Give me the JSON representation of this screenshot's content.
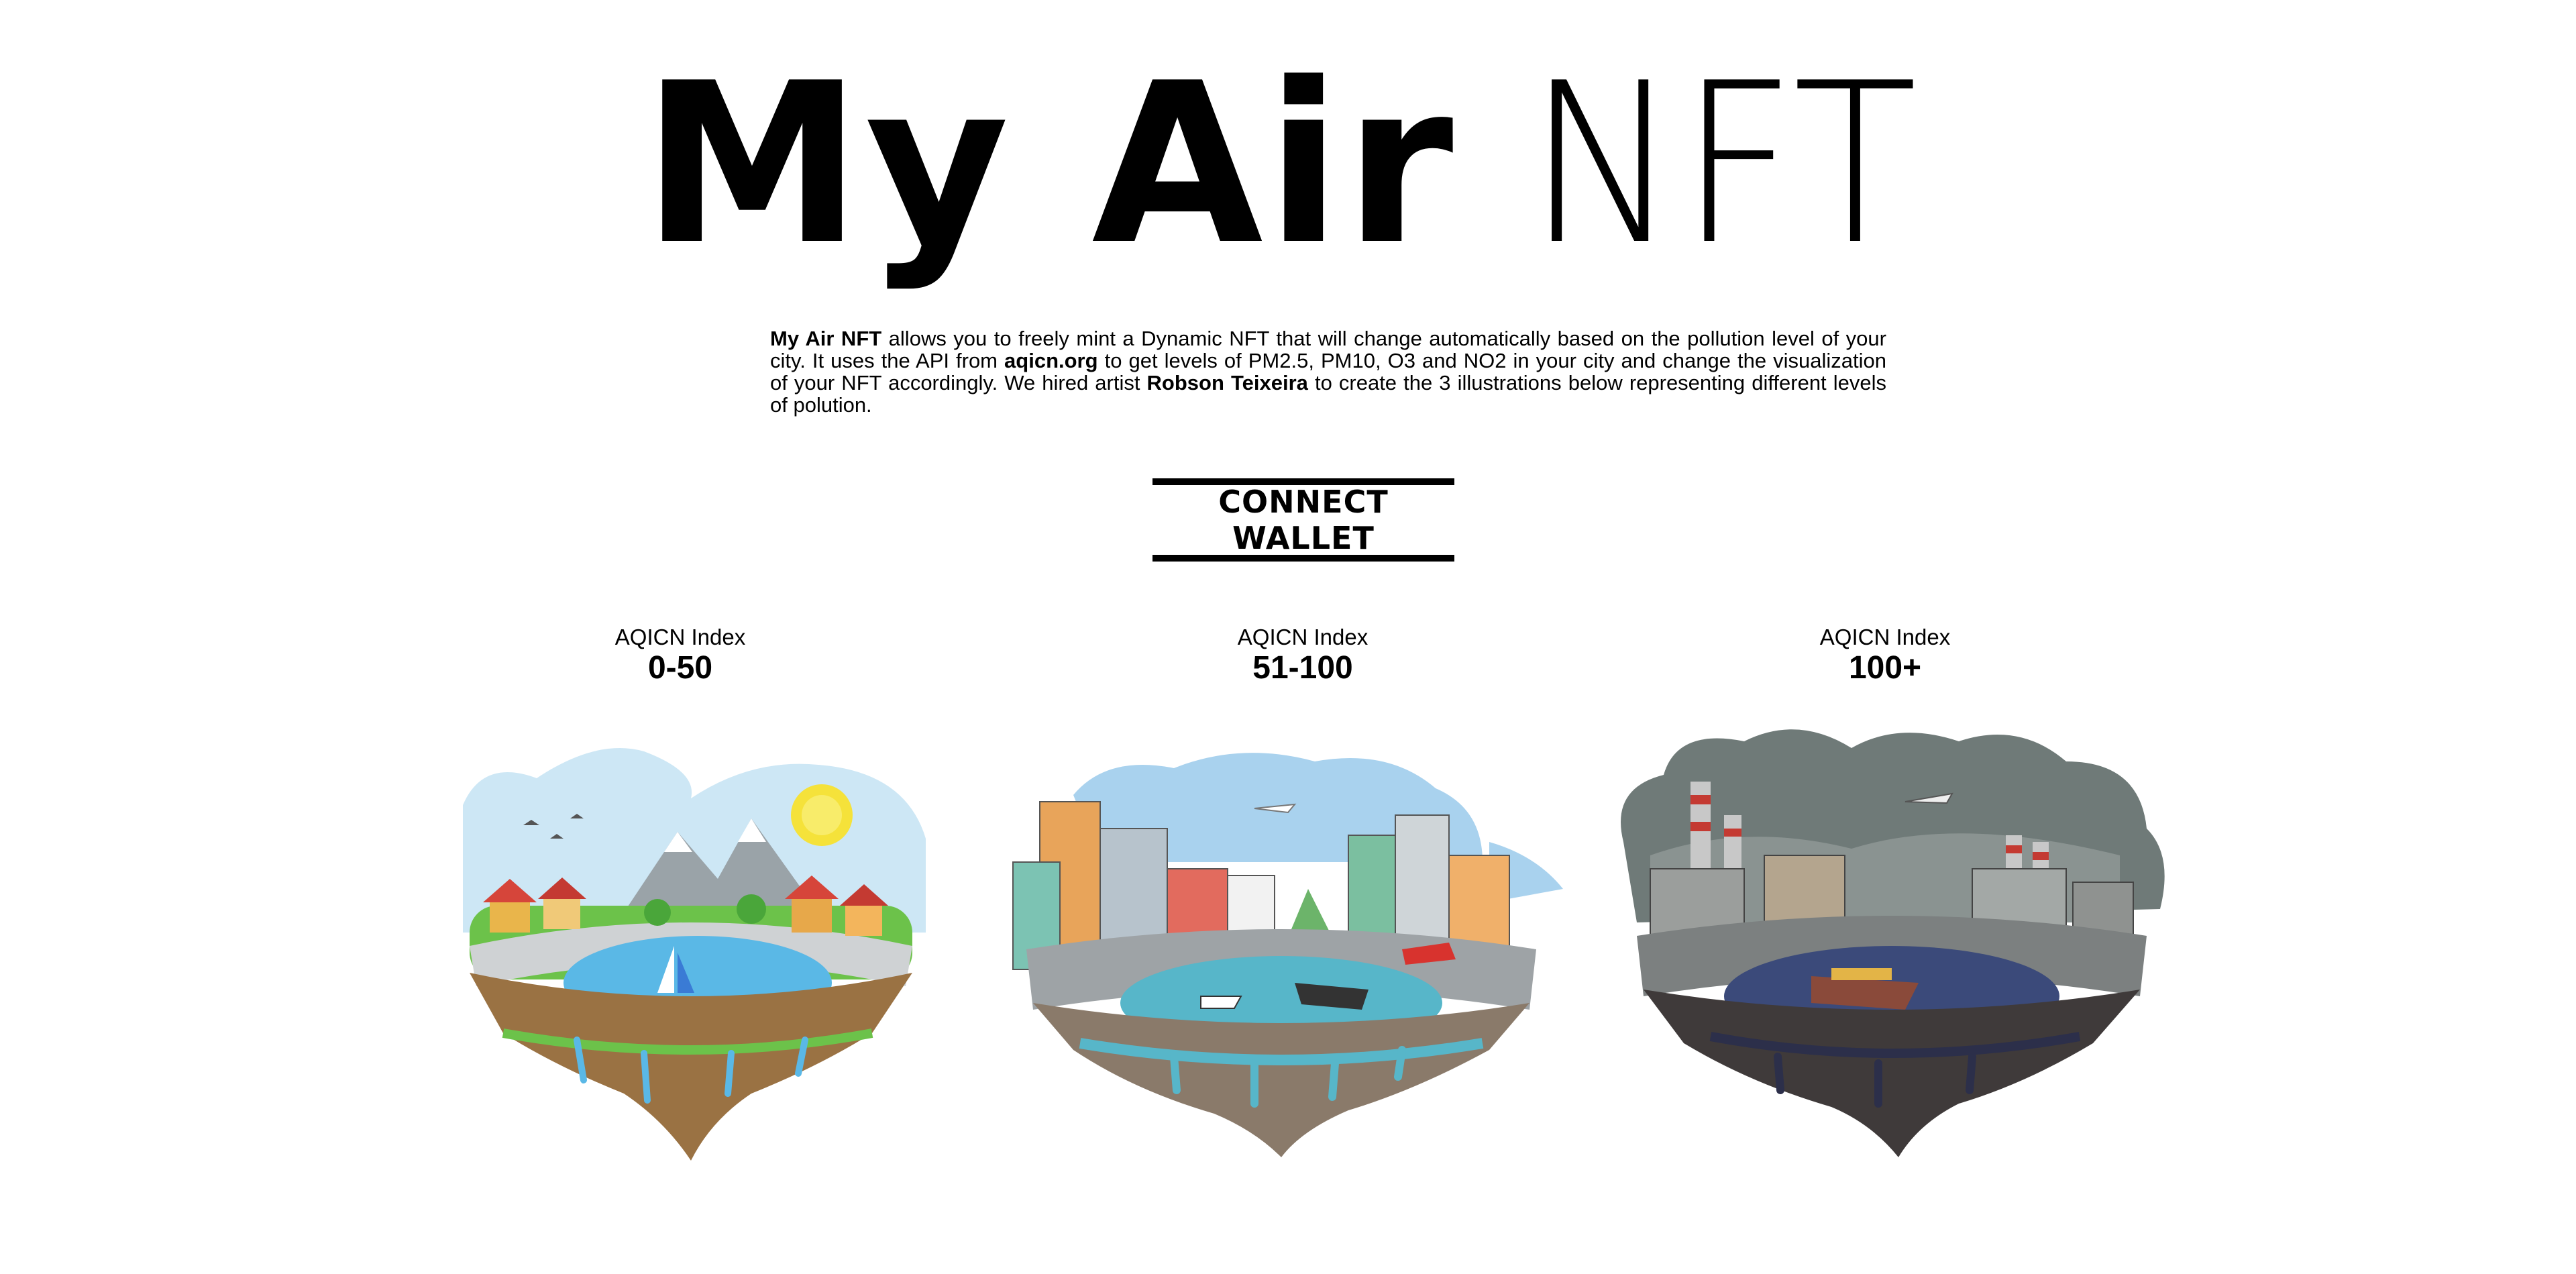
{
  "header": {
    "title_bold": "My Air",
    "title_thin": "NFT"
  },
  "intro": {
    "brand": "My Air NFT",
    "text1": " allows you to freely mint a Dynamic NFT that will change automatically based on the pollution level of your city. It uses the API from ",
    "api_site": "aqicn.org",
    "text2": " to get levels of PM2.5, PM10, O3 and NO2 in your city and change the visualization of your NFT accordingly. We hired artist ",
    "artist": "Robson Teixeira",
    "text3": " to create the 3 illustrations below representing different levels of polution."
  },
  "wallet": {
    "connect_label": "CONNECT WALLET"
  },
  "tiers": [
    {
      "label": "AQICN Index",
      "range": "0-50",
      "scene": "clean-island-illustration"
    },
    {
      "label": "AQICN Index",
      "range": "51-100",
      "scene": "moderate-city-island-illustration"
    },
    {
      "label": "AQICN Index",
      "range": "100+",
      "scene": "polluted-industrial-island-illustration"
    }
  ],
  "colors": {
    "sky_clean": "#cde7f5",
    "sky_moderate": "#a9d2ee",
    "smog": "#6f7a78",
    "water_clean": "#5ab8e6",
    "water_polluted": "#3b4a7a",
    "grass": "#6cc24a",
    "soil": "#9a7243"
  }
}
